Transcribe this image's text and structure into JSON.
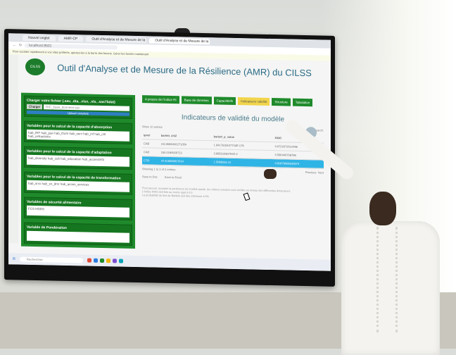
{
  "browser": {
    "tabs": [
      "Nouvel onglet",
      "AMR-CP",
      "Outil d'Analyse et de Mesure de la Résilience",
      "Outil d'Analyse et de Mesure de la Résilience"
    ],
    "url": "localhost:8501",
    "infobar": "Pour accéder rapidement à vos sites préférés, ajoutez-les à la barre des favoris. Gérer les favoris maintenant"
  },
  "app": {
    "title": "Outil d'Analyse et de Mesure de la Résilience (AMR) du CILSS",
    "logo_text": "CILSS"
  },
  "sidebar": {
    "upload": {
      "title": "Charger votre fichier (.sav, .dta, .xlsx, .xls, .sas7bdat)",
      "button": "Charger",
      "file_name": "RIC_base_donnees.sav",
      "status": "Upload complete"
    },
    "sections": [
      {
        "title": "Variables pour le calcul de la capacité d'absorption",
        "chips": "hab_IRF  hab_pan  hab_thom  hab_serv  hab_inf  hab_ctrl  hab_cefractions"
      },
      {
        "title": "Variables pour le calcul de la capacité d'adaptation",
        "chips": "hab_diversity  hab_cult  hab_education  hab_accessinfo"
      },
      {
        "title": "Variables pour le calcul de la capacité de transformation",
        "chips": "hab_srvx  hab_sn_dmr  hab_acces_services"
      },
      {
        "title": "Variables de sécurité alimentaire",
        "chips": "FCS  HDDS"
      },
      {
        "title": "Variable de Pondération",
        "chips": ""
      }
    ]
  },
  "nav": {
    "tabs": [
      "A propos de l'indice RI",
      "Base de données",
      "Capacitésfs",
      "Indicateurs validité",
      "Structure",
      "Tabulation"
    ],
    "active_index": 3
  },
  "panel": {
    "title": "Indicateurs de validité du modèle",
    "show_label": "Show",
    "show_value": "10",
    "entries_label": "entries",
    "search_label": "Search:",
    "columns": [
      "ipnel",
      "barlett_chi2",
      "barlett_p_value",
      "KMO"
    ],
    "rows": [
      [
        "CAB",
        "311.8983491271054",
        "1.9417618107716E-178",
        "0.6722072012496"
      ],
      [
        "CAD",
        "154.0194926713",
        "3.86521060791E-2",
        "0.580440708798"
      ],
      [
        "CTR",
        "47.618009917024",
        "1.508803e-12",
        "0.60679966030574"
      ]
    ],
    "highlight_row": 2,
    "info": "Showing 1 to 3 of 3 entries",
    "prev": "Previous",
    "next": "Next",
    "buttons": [
      "Save to Doc",
      "Save to Excel"
    ],
    "notes": [
      "Pour pouvoir accepter la pertinence du modèle ajusté, les critères suivants sont vérifiés au niveau des différentes dimensions",
      "L'indice KMO doit être au moins égal à 0.5",
      "La probabilité du test de Bartlett doit être inférieure à 5%"
    ]
  },
  "taskbar": {
    "search": "Rechercher"
  },
  "colors": {
    "green": "#1f8a2b",
    "title_blue": "#2b6a86",
    "highlight": "#2fb4e6",
    "active_tab": "#f1d44a"
  }
}
